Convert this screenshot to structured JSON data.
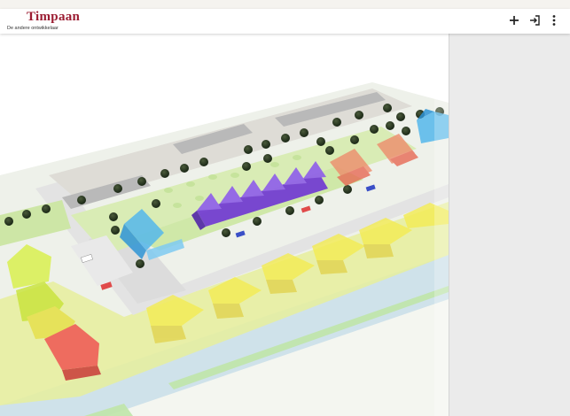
{
  "app": {
    "logo": "Timpaan",
    "tagline": "De andere ontwikkelaar"
  },
  "toolbar": {
    "add_icon": "plus-icon",
    "login_icon": "sign-in-icon",
    "menu_icon": "more-vertical-icon"
  },
  "colors": {
    "brand": "#9b1d32",
    "plot_yellow": "#f2ee6c",
    "plot_green": "#b6e37a",
    "house_red": "#ee4b4b",
    "house_purple": "#7a3ce6",
    "house_blue": "#3aa9e6",
    "house_orange": "#f2a45a",
    "water": "#c8e0e8",
    "park": "#cfe8a8",
    "sidepanel": "#ebebeb"
  }
}
